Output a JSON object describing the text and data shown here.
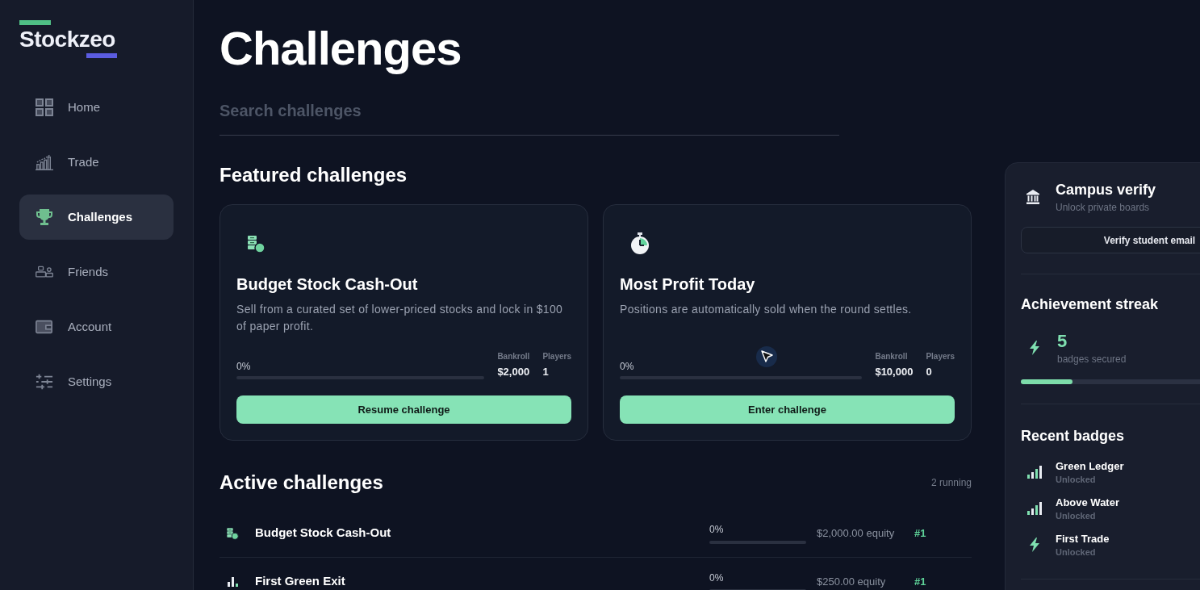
{
  "logo": {
    "text": "Stockzeo"
  },
  "sidebar": {
    "items": [
      {
        "label": "Home",
        "selected": false
      },
      {
        "label": "Trade",
        "selected": false
      },
      {
        "label": "Challenges",
        "selected": true
      },
      {
        "label": "Friends",
        "selected": false
      },
      {
        "label": "Account",
        "selected": false
      },
      {
        "label": "Settings",
        "selected": false
      }
    ]
  },
  "page": {
    "title": "Challenges"
  },
  "search": {
    "placeholder": "Search challenges"
  },
  "featured": {
    "heading": "Featured challenges",
    "cards": [
      {
        "title": "Budget Stock Cash-Out",
        "description": "Sell from a curated set of lower-priced stocks and lock in $100 of paper profit.",
        "progress": "0%",
        "level": 0,
        "stats": [
          {
            "label": "Bankroll",
            "value": "$2,000"
          },
          {
            "label": "Players",
            "value": "1"
          }
        ],
        "button": "Resume challenge"
      },
      {
        "title": "Most Profit Today",
        "description": "Positions are automatically sold when the round settles.",
        "progress": "0%",
        "level": 0,
        "stats": [
          {
            "label": "Bankroll",
            "value": "$10,000"
          },
          {
            "label": "Players",
            "value": "0"
          }
        ],
        "button": "Enter challenge"
      }
    ]
  },
  "active": {
    "heading": "Active challenges",
    "count": "2 running",
    "rows": [
      {
        "title": "Budget Stock Cash-Out",
        "progress": "0%",
        "level": 0,
        "equity": "$2,000.00 equity",
        "rank": "#1"
      },
      {
        "title": "First Green Exit",
        "progress": "0%",
        "level": 0,
        "equity": "$250.00 equity",
        "rank": "#1"
      }
    ]
  },
  "side_panel": {
    "campus": {
      "title": "Campus verify",
      "subtitle": "Unlock private boards",
      "button": "Verify student email"
    },
    "streak": {
      "heading": "Achievement streak",
      "count": "5",
      "caption": "badges secured",
      "level": 0.2
    },
    "badges": {
      "heading": "Recent badges",
      "items": [
        {
          "name": "Green Ledger",
          "status": "Unlocked"
        },
        {
          "name": "Above Water",
          "status": "Unlocked"
        },
        {
          "name": "First Trade",
          "status": "Unlocked"
        }
      ]
    }
  }
}
